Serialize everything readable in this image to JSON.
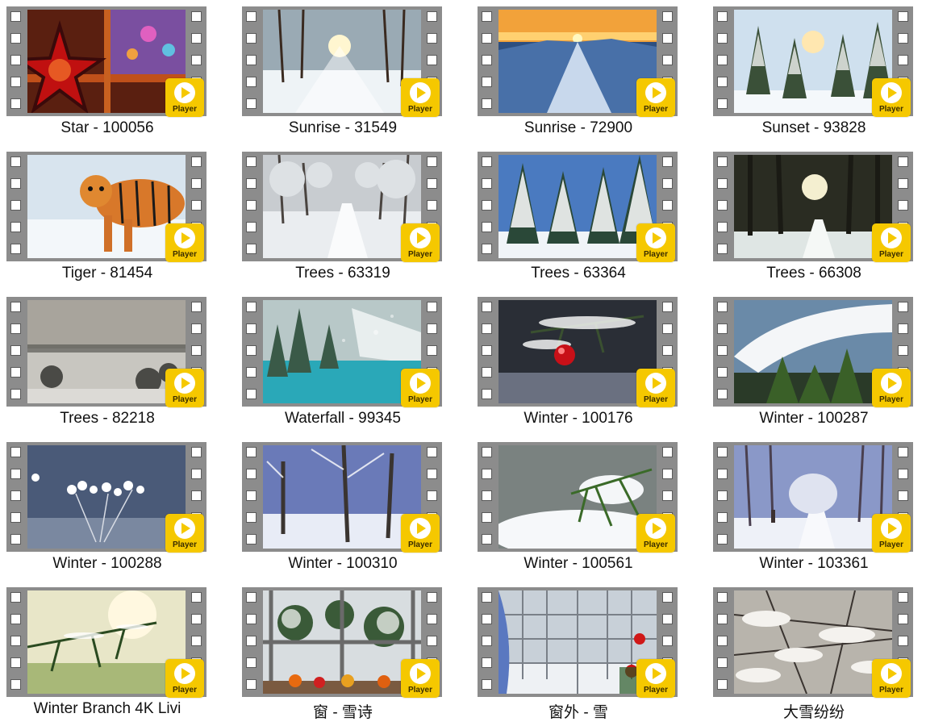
{
  "player_label": "Player",
  "items": [
    {
      "title": "Star - 100056",
      "scene": "star"
    },
    {
      "title": "Sunrise - 31549",
      "scene": "snowforest"
    },
    {
      "title": "Sunrise - 72900",
      "scene": "mountain"
    },
    {
      "title": "Sunset - 93828",
      "scene": "pines"
    },
    {
      "title": "Tiger - 81454",
      "scene": "tiger"
    },
    {
      "title": "Trees - 63319",
      "scene": "trees-lane"
    },
    {
      "title": "Trees - 63364",
      "scene": "snowy-spruce"
    },
    {
      "title": "Trees - 66308",
      "scene": "dark-forest"
    },
    {
      "title": "Trees - 82218",
      "scene": "fog"
    },
    {
      "title": "Waterfall - 99345",
      "scene": "lake"
    },
    {
      "title": "Winter - 100176",
      "scene": "ornament"
    },
    {
      "title": "Winter - 100287",
      "scene": "snow-branch"
    },
    {
      "title": "Winter - 100288",
      "scene": "frost-flowers"
    },
    {
      "title": "Winter - 100310",
      "scene": "blue-trees"
    },
    {
      "title": "Winter - 100561",
      "scene": "green-snow"
    },
    {
      "title": "Winter - 103361",
      "scene": "snow-path"
    },
    {
      "title": "Winter Branch 4K Livi",
      "scene": "pine-branch"
    },
    {
      "title": "窗 - 雪诗",
      "scene": "window-fruit"
    },
    {
      "title": "窗外 - 雪",
      "scene": "window-snow"
    },
    {
      "title": "大雪纷纷",
      "scene": "heavy-snow"
    }
  ]
}
